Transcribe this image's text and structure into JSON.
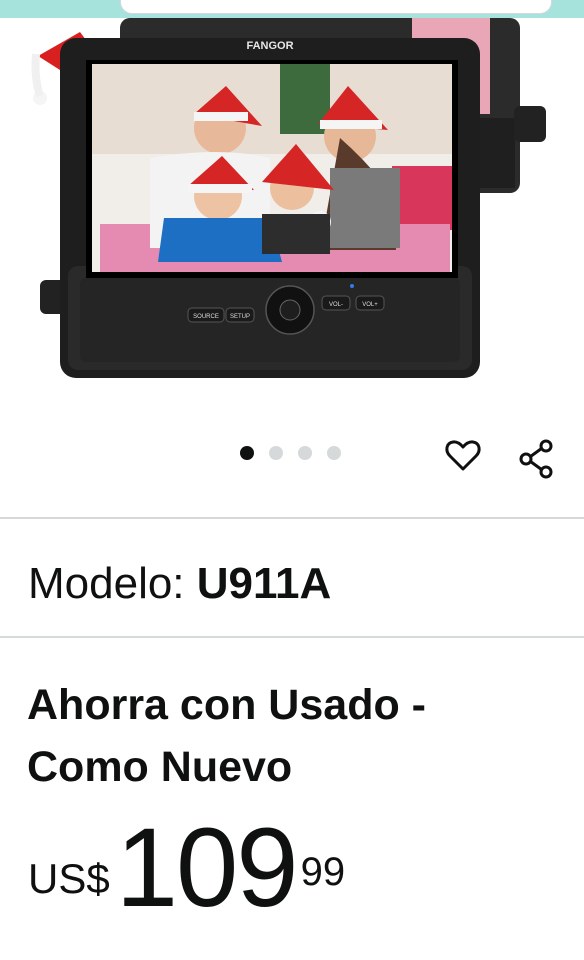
{
  "gallery": {
    "brand_text": "FANGOR",
    "buttons": {
      "source": "SOURCE",
      "setup": "SETUP",
      "vol_minus": "VOL-",
      "vol_plus": "VOL+"
    },
    "dot_count": 4,
    "active_dot": 0
  },
  "actions": {
    "favorite_icon": "heart-icon",
    "share_icon": "share-icon"
  },
  "model": {
    "label": "Modelo: ",
    "value": "U911A"
  },
  "offer": {
    "title": "Ahorra con Usado - Como Nuevo"
  },
  "price": {
    "currency": "US$",
    "whole": "109",
    "fraction": "99"
  }
}
